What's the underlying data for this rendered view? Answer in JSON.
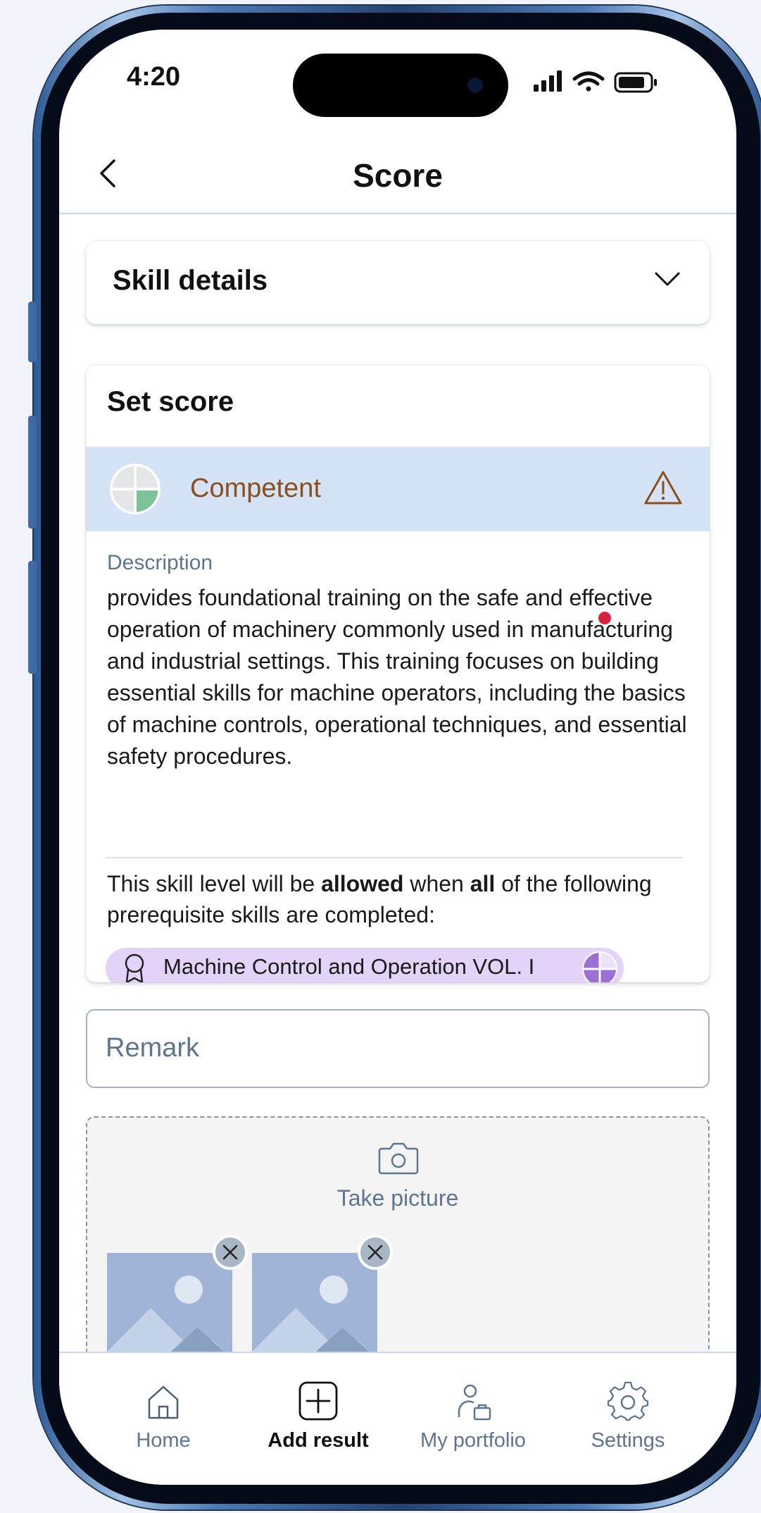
{
  "status_bar": {
    "time": "4:20"
  },
  "nav": {
    "title": "Score"
  },
  "skill_details": {
    "title": "Skill details"
  },
  "set_score": {
    "title": "Set score",
    "level_label": "Competent",
    "description_label": "Description",
    "description": "provides foundational training on the safe and effective operation of machinery commonly used in manufacturing and industrial settings. This training focuses on building essential skills for machine operators, including the basics of machine controls, operational techniques, and essential safety procedures.",
    "prereq": {
      "part1": "This skill level will be ",
      "bold1": "allowed",
      "part2": " when ",
      "bold2": "all",
      "part3": " of the following prerequisite skills are completed:"
    },
    "prereq_chip": {
      "label": "Machine Control and Operation VOL. I",
      "accent": "#e3d3f8"
    }
  },
  "remark": {
    "placeholder": "Remark"
  },
  "photos": {
    "take_label": "Take picture"
  },
  "tab_bar": {
    "tabs": [
      {
        "label": "Home",
        "icon": "home-icon"
      },
      {
        "label": "Add result",
        "icon": "plus-square-icon"
      },
      {
        "label": "My portfolio",
        "icon": "person-briefcase-icon"
      },
      {
        "label": "Settings",
        "icon": "gear-icon"
      }
    ],
    "active_tab": "Add result"
  },
  "colors": {
    "level_row_bg": "#d4e3f6",
    "level_text": "#8a4f1c",
    "muted_text": "#5d7590",
    "notification_dot": "#d6253b"
  }
}
